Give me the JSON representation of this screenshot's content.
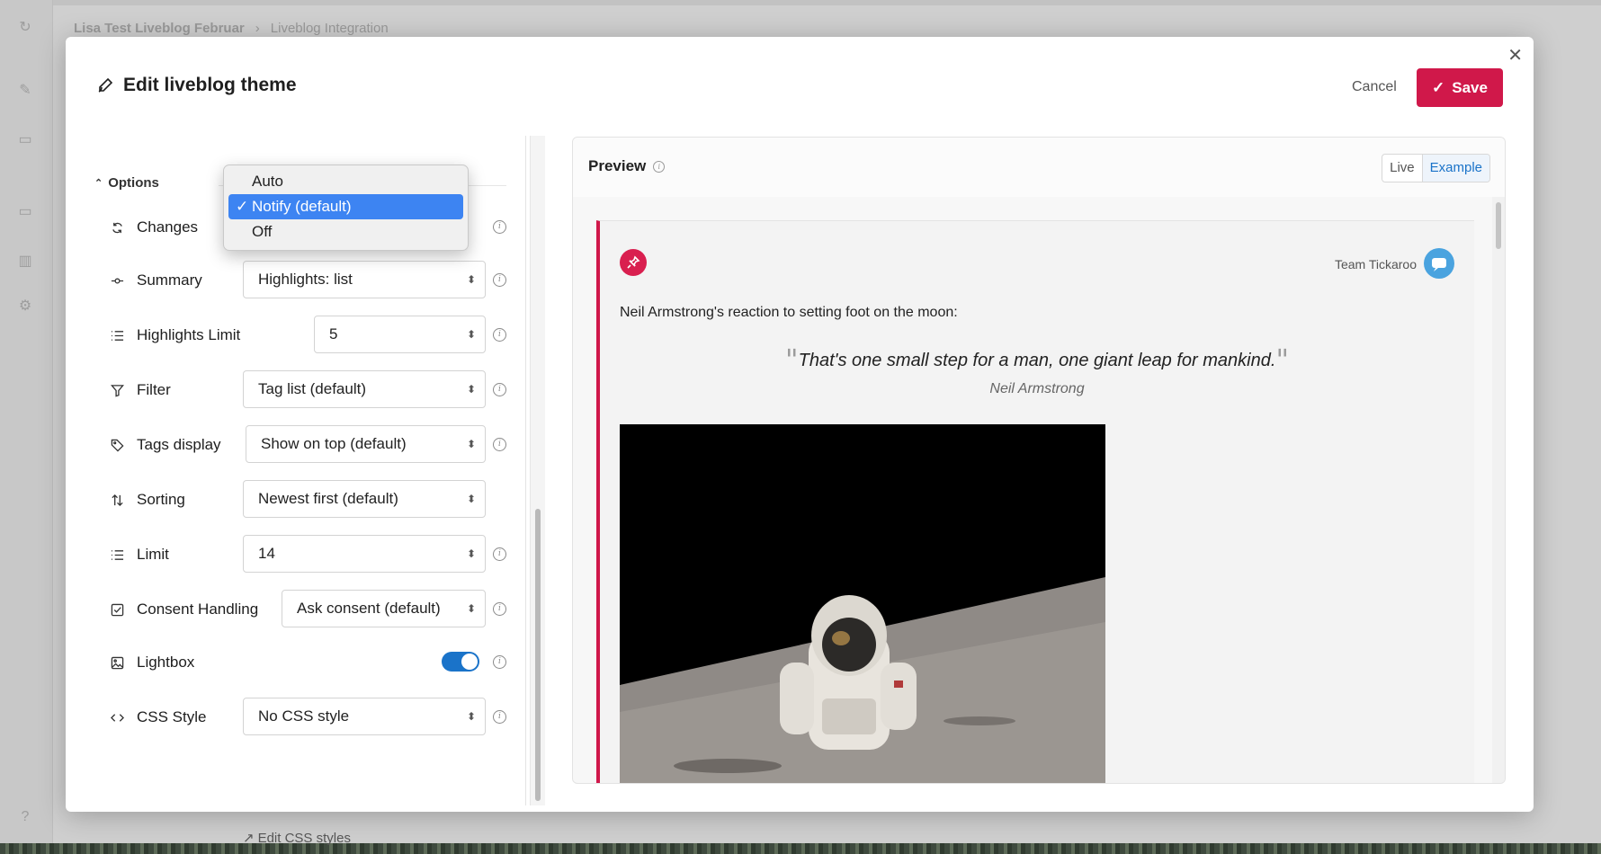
{
  "background": {
    "breadcrumb": [
      "Lisa Test Liveblog Februar",
      "Liveblog Integration"
    ]
  },
  "modal": {
    "title": "Edit liveblog theme",
    "cancel_label": "Cancel",
    "save_label": "Save",
    "accent_color": "#d0184a"
  },
  "options": {
    "header": "Options",
    "rows": {
      "changes": {
        "label": "Changes",
        "icon": "refresh-icon"
      },
      "summary": {
        "label": "Summary",
        "value": "Highlights: list",
        "icon": "commit-icon"
      },
      "highlights_limit": {
        "label": "Highlights Limit",
        "value": "5",
        "icon": "list-icon"
      },
      "filter": {
        "label": "Filter",
        "value": "Tag list (default)",
        "icon": "filter-icon"
      },
      "tags_display": {
        "label": "Tags display",
        "value": "Show on top (default)",
        "icon": "tag-icon"
      },
      "sorting": {
        "label": "Sorting",
        "value": "Newest first (default)",
        "icon": "sort-icon"
      },
      "limit": {
        "label": "Limit",
        "value": "14",
        "icon": "list-icon"
      },
      "consent": {
        "label": "Consent Handling",
        "value": "Ask consent (default)",
        "icon": "checkbox-icon"
      },
      "lightbox": {
        "label": "Lightbox",
        "enabled": true,
        "icon": "image-icon"
      },
      "css_style": {
        "label": "CSS Style",
        "value": "No CSS style",
        "icon": "code-icon"
      }
    },
    "edit_css_label": "Edit CSS styles"
  },
  "changes_dropdown": {
    "options": [
      "Auto",
      "Notify (default)",
      "Off"
    ],
    "selected": "Notify (default)",
    "check_mark": "✓"
  },
  "preview": {
    "title": "Preview",
    "tabs": {
      "live": "Live",
      "example": "Example"
    },
    "active_tab": "Example",
    "post": {
      "author": "Team Tickaroo",
      "text": "Neil Armstrong's reaction to setting foot on the moon:",
      "quote": "That's one small step for a man, one giant leap for mankind.",
      "quote_author": "Neil Armstrong"
    }
  }
}
